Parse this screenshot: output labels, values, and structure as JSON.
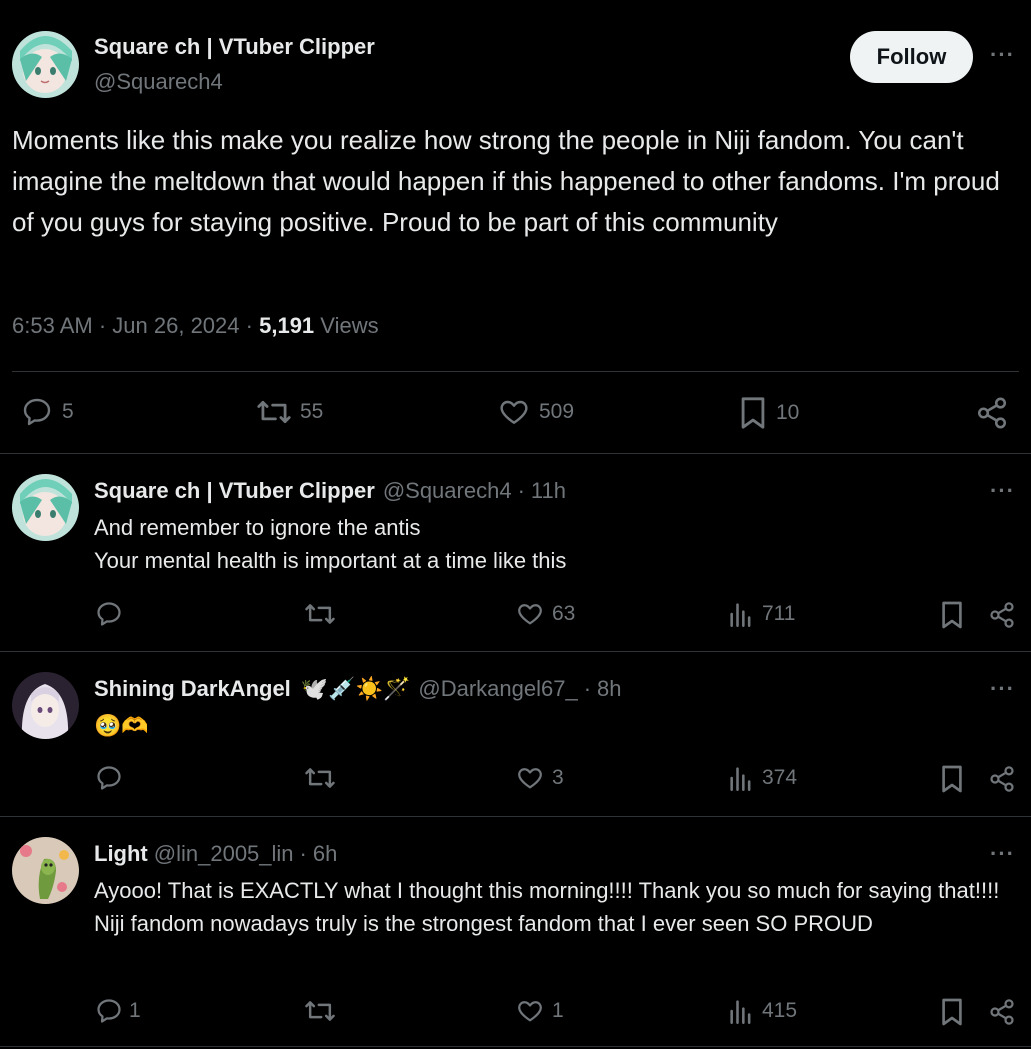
{
  "main_post": {
    "display_name": "Square ch | VTuber Clipper",
    "handle": "@Squarech4",
    "follow_label": "Follow",
    "more_label": "···",
    "text": "Moments like this make you realize how strong the people in Niji fandom. You can't imagine the meltdown that would happen if this happened to other fandoms. I'm proud of you guys for staying positive. Proud to be part of this community",
    "time": "6:53 AM",
    "date": "Jun 26, 2024",
    "views_count": "5,191",
    "views_label": "Views",
    "stats": {
      "replies": "5",
      "reposts": "55",
      "likes": "509",
      "bookmarks": "10"
    }
  },
  "replies": [
    {
      "display_name": "Square ch | VTuber Clipper",
      "handle": "@Squarech4",
      "time": "11h",
      "line1": "And remember to ignore the antis",
      "line2": "Your mental health is important at a time like this",
      "replies": "",
      "likes": "63",
      "views": "711"
    },
    {
      "display_name": "Shining DarkAngel",
      "name_emoji": "🕊️💉☀️🪄",
      "handle": "@Darkangel67_",
      "time": "8h",
      "line1": "🥹🫶",
      "replies": "",
      "likes": "3",
      "views": "374"
    },
    {
      "display_name": "Light",
      "handle": "@lin_2005_lin",
      "time": "6h",
      "text": "Ayooo! That is EXACTLY what I thought this morning!!!! Thank you so much for saying that!!!! Niji fandom nowadays truly is the strongest fandom that I ever seen SO PROUD",
      "replies": "1",
      "likes": "1",
      "views": "415"
    }
  ],
  "icons": [
    "reply-icon",
    "repost-icon",
    "like-icon",
    "bookmark-icon",
    "share-icon",
    "views-icon",
    "more-icon"
  ],
  "colors": {
    "background": "#000000",
    "text": "#e7e9ea",
    "muted": "#71767b",
    "divider": "#2f3336",
    "follow_bg": "#eff3f4"
  }
}
